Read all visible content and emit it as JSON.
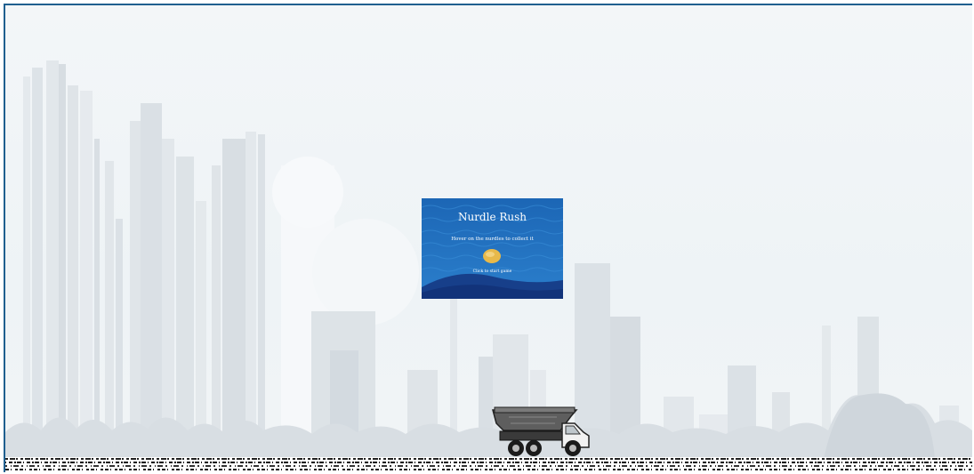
{
  "game": {
    "title": "Nurdle Rush",
    "instruction": "Hover on the nurdles to collect it",
    "start_prompt": "Click to start game"
  },
  "colors": {
    "frame_border": "#1f5f8f",
    "sky": "#f3f6f8",
    "card_blue": "#1f6fb8",
    "card_wave": "#1a4e9a",
    "nurdle": "#e8b94a",
    "truck_body": "#555555",
    "ground": "#111111"
  },
  "icons": {
    "nurdle": "nurdle-pellet-icon",
    "truck": "dump-truck-icon"
  }
}
